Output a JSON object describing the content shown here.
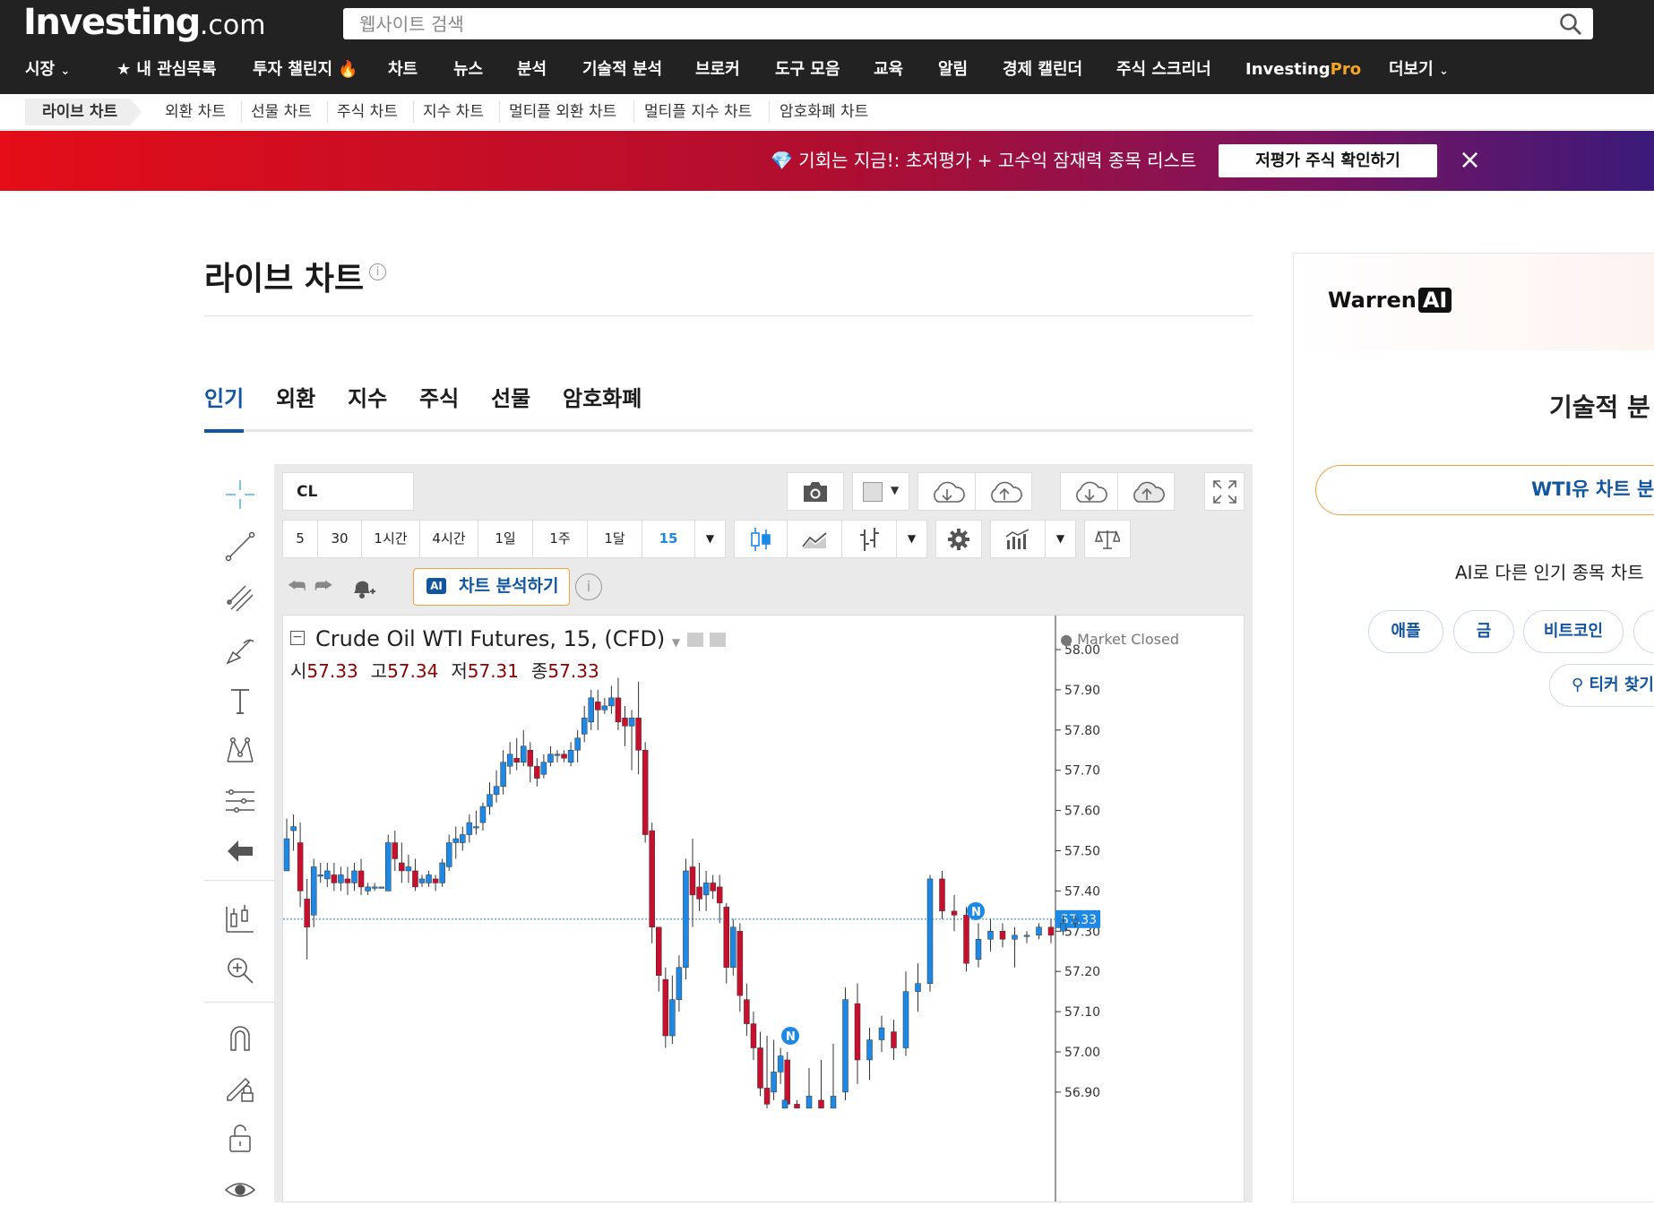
{
  "header": {
    "logo_main": "Investing",
    "logo_suffix": ".com",
    "search_placeholder": "웹사이트 검색"
  },
  "nav": {
    "items": [
      "시장",
      "내 관심목록",
      "투자 챌린지",
      "차트",
      "뉴스",
      "분석",
      "기술적 분석",
      "브로커",
      "도구 모음",
      "교육",
      "알림",
      "경제 캘린더",
      "주식 스크리너",
      "InvestingPro",
      "더보기"
    ]
  },
  "subnav": {
    "items": [
      "라이브 차트",
      "외환 차트",
      "선물 차트",
      "주식 차트",
      "지수 차트",
      "멀티플 외환 차트",
      "멀티플 지수 차트",
      "암호화폐 차트"
    ]
  },
  "banner": {
    "text": "기회는 지금!: 초저평가 + 고수익 잠재력 종목 리스트",
    "button": "저평가 주식 확인하기",
    "close": "×"
  },
  "page": {
    "title": "라이브 차트"
  },
  "tabs": [
    "인기",
    "외환",
    "지수",
    "주식",
    "선물",
    "암호화폐"
  ],
  "chart_toolbar": {
    "symbol": "CL",
    "intervals": [
      "5",
      "30",
      "1시간",
      "4시간",
      "1일",
      "1주",
      "1달",
      "15"
    ],
    "ai_button": "차트 분석하기",
    "ai_badge": "AI"
  },
  "chart_data": {
    "type": "candlestick",
    "title": "Crude Oil WTI Futures, 15, (CFD)",
    "status": "Market Closed",
    "ohlc_labels": [
      "시",
      "고",
      "저",
      "종"
    ],
    "ohlc_values": [
      "57.33",
      "57.34",
      "57.31",
      "57.33"
    ],
    "last_price": "57.33",
    "ylim": [
      56.86,
      58.05
    ],
    "y_ticks": [
      "58.00",
      "57.90",
      "57.80",
      "57.70",
      "57.60",
      "57.50",
      "57.40",
      "57.30",
      "57.20",
      "57.10",
      "57.00",
      "56.90"
    ],
    "news_marker": "N",
    "colors": {
      "up": "#1e88e5",
      "down": "#c8102e"
    },
    "candles": [
      [
        57.45,
        57.53,
        57.49,
        57.58
      ],
      [
        57.55,
        57.56,
        57.5,
        57.59
      ],
      [
        57.52,
        57.4,
        57.36,
        57.57
      ],
      [
        57.38,
        57.31,
        57.23,
        57.43
      ],
      [
        57.34,
        57.46,
        57.31,
        57.48
      ],
      [
        57.44,
        57.44,
        57.42,
        57.47
      ],
      [
        57.43,
        57.45,
        57.41,
        57.47
      ],
      [
        57.44,
        57.42,
        57.4,
        57.47
      ],
      [
        57.42,
        57.44,
        57.4,
        57.46
      ],
      [
        57.43,
        57.42,
        57.39,
        57.46
      ],
      [
        57.42,
        57.45,
        57.4,
        57.47
      ],
      [
        57.45,
        57.41,
        57.39,
        57.48
      ],
      [
        57.4,
        57.41,
        57.39,
        57.42
      ],
      [
        57.41,
        57.41,
        57.4,
        57.42
      ],
      [
        57.41,
        57.41,
        57.41,
        57.41
      ],
      [
        57.4,
        57.52,
        57.4,
        57.54
      ],
      [
        57.52,
        57.48,
        57.45,
        57.55
      ],
      [
        57.47,
        57.45,
        57.42,
        57.52
      ],
      [
        57.45,
        57.46,
        57.42,
        57.49
      ],
      [
        57.45,
        57.41,
        57.4,
        57.48
      ],
      [
        57.42,
        57.43,
        57.41,
        57.44
      ],
      [
        57.42,
        57.44,
        57.41,
        57.45
      ],
      [
        57.43,
        57.42,
        57.4,
        57.44
      ],
      [
        57.42,
        57.47,
        57.41,
        57.48
      ],
      [
        57.46,
        57.52,
        57.45,
        57.54
      ],
      [
        57.52,
        57.53,
        57.48,
        57.56
      ],
      [
        57.52,
        57.54,
        57.5,
        57.56
      ],
      [
        57.54,
        57.57,
        57.52,
        57.59
      ],
      [
        57.56,
        57.56,
        57.54,
        57.6
      ],
      [
        57.57,
        57.61,
        57.55,
        57.62
      ],
      [
        57.61,
        57.64,
        57.59,
        57.67
      ],
      [
        57.64,
        57.66,
        57.62,
        57.7
      ],
      [
        57.66,
        57.72,
        57.64,
        57.75
      ],
      [
        57.71,
        57.74,
        57.69,
        57.77
      ],
      [
        57.73,
        57.72,
        57.7,
        57.78
      ],
      [
        57.72,
        57.76,
        57.71,
        57.8
      ],
      [
        57.75,
        57.71,
        57.67,
        57.77
      ],
      [
        57.71,
        57.68,
        57.66,
        57.73
      ],
      [
        57.69,
        57.72,
        57.68,
        57.74
      ],
      [
        57.72,
        57.74,
        57.71,
        57.76
      ],
      [
        57.74,
        57.74,
        57.72,
        57.75
      ],
      [
        57.74,
        57.73,
        57.72,
        57.75
      ],
      [
        57.72,
        57.75,
        57.71,
        57.77
      ],
      [
        57.75,
        57.78,
        57.72,
        57.8
      ],
      [
        57.79,
        57.83,
        57.77,
        57.86
      ],
      [
        57.82,
        57.88,
        57.8,
        57.9
      ],
      [
        57.87,
        57.85,
        57.8,
        57.9
      ],
      [
        57.85,
        57.86,
        57.84,
        57.88
      ],
      [
        57.86,
        57.88,
        57.84,
        57.91
      ],
      [
        57.88,
        57.82,
        57.8,
        57.93
      ],
      [
        57.83,
        57.81,
        57.76,
        57.86
      ],
      [
        57.81,
        57.83,
        57.7,
        57.85
      ],
      [
        57.83,
        57.75,
        57.69,
        57.92
      ],
      [
        57.75,
        57.54,
        57.52,
        57.77
      ],
      [
        57.55,
        57.31,
        57.27,
        57.57
      ],
      [
        57.31,
        57.19,
        57.15,
        57.3
      ],
      [
        57.18,
        57.04,
        57.01,
        57.21
      ],
      [
        57.04,
        57.13,
        57.02,
        57.19
      ],
      [
        57.13,
        57.21,
        57.1,
        57.24
      ],
      [
        57.21,
        57.45,
        57.18,
        57.48
      ],
      [
        57.46,
        57.39,
        57.31,
        57.53
      ],
      [
        57.41,
        57.38,
        57.35,
        57.47
      ],
      [
        57.39,
        57.42,
        57.35,
        57.45
      ],
      [
        57.42,
        57.4,
        57.38,
        57.44
      ],
      [
        57.41,
        57.37,
        57.32,
        57.44
      ],
      [
        57.36,
        57.21,
        57.17,
        57.37
      ],
      [
        57.21,
        57.31,
        57.19,
        57.33
      ],
      [
        57.3,
        57.14,
        57.1,
        57.32
      ],
      [
        57.13,
        57.07,
        57.04,
        57.17
      ],
      [
        57.07,
        57.01,
        56.98,
        57.1
      ],
      [
        57.01,
        56.91,
        56.89,
        57.05
      ],
      [
        56.91,
        56.87,
        56.86,
        57.04
      ],
      [
        56.9,
        56.95,
        56.88,
        57.03
      ],
      [
        56.95,
        56.99,
        56.92,
        57.01
      ],
      [
        56.98,
        56.87,
        56.86,
        57.0
      ]
    ],
    "candles_right": [
      [
        56.86,
        56.88,
        56.86,
        56.89
      ],
      [
        56.87,
        56.86,
        56.86,
        56.88
      ],
      [
        56.86,
        56.89,
        56.86,
        56.96
      ],
      [
        56.88,
        56.86,
        56.86,
        56.98
      ],
      [
        56.86,
        56.89,
        56.86,
        57.02
      ],
      [
        56.9,
        57.13,
        56.88,
        57.16
      ],
      [
        57.12,
        56.98,
        56.92,
        57.17
      ],
      [
        56.98,
        57.03,
        56.93,
        57.06
      ],
      [
        57.03,
        57.06,
        57.0,
        57.09
      ],
      [
        57.05,
        57.01,
        56.98,
        57.08
      ],
      [
        57.01,
        57.15,
        56.99,
        57.2
      ],
      [
        57.15,
        57.17,
        57.1,
        57.22
      ],
      [
        57.17,
        57.43,
        57.15,
        57.44
      ],
      [
        57.43,
        57.35,
        57.33,
        57.45
      ],
      [
        57.35,
        57.34,
        57.3,
        57.39
      ],
      [
        57.34,
        57.22,
        57.2,
        57.36
      ],
      [
        57.23,
        57.28,
        57.21,
        57.32
      ],
      [
        57.28,
        57.3,
        57.25,
        57.33
      ],
      [
        57.3,
        57.28,
        57.26,
        57.32
      ],
      [
        57.28,
        57.29,
        57.21,
        57.31
      ],
      [
        57.29,
        57.29,
        57.27,
        57.3
      ],
      [
        57.29,
        57.31,
        57.28,
        57.32
      ],
      [
        57.31,
        57.29,
        57.27,
        57.33
      ],
      [
        57.3,
        57.32,
        57.29,
        57.34
      ],
      [
        57.32,
        57.33,
        57.31,
        57.34
      ]
    ]
  },
  "right_panel": {
    "brand": "Warren",
    "brand_ai": "AI",
    "title": "기술적 분",
    "cta": "WTI유 차트 분석",
    "subtitle": "AI로 다른 인기 종목 차트",
    "pills": [
      "애플",
      "금",
      "비트코인"
    ],
    "ticker_search": "티커 찾기"
  }
}
